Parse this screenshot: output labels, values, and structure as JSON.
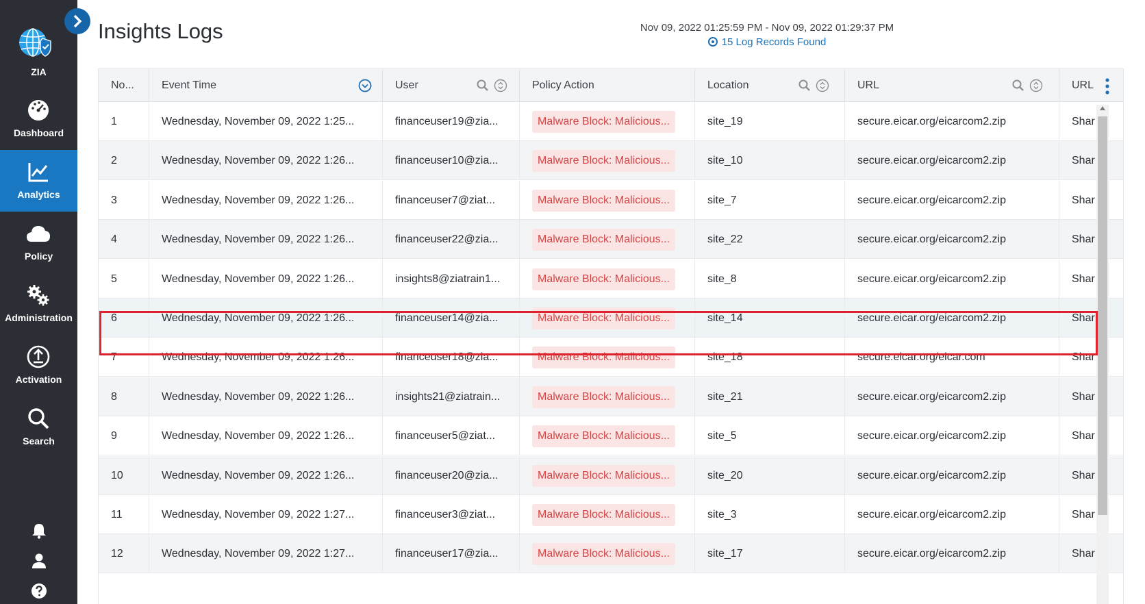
{
  "sidebar": {
    "logo_label": "ZIA",
    "items": [
      {
        "label": "Dashboard",
        "icon": "dashboard-gauge-icon"
      },
      {
        "label": "Analytics",
        "icon": "analytics-chart-icon",
        "active": true
      },
      {
        "label": "Policy",
        "icon": "cloud-icon"
      },
      {
        "label": "Administration",
        "icon": "gears-icon"
      },
      {
        "label": "Activation",
        "icon": "upload-circle-icon"
      },
      {
        "label": "Search",
        "icon": "search-icon"
      }
    ],
    "bottom_icons": [
      "bell-icon",
      "user-icon",
      "help-icon"
    ]
  },
  "header": {
    "title": "Insights Logs",
    "date_range": "Nov 09, 2022 01:25:59 PM  -  Nov 09, 2022 01:29:37 PM",
    "records_found": "15 Log Records Found"
  },
  "table": {
    "columns": [
      "No...",
      "Event Time",
      "User",
      "Policy Action",
      "Location",
      "URL",
      "URL"
    ],
    "rows": [
      {
        "no": "1",
        "time": "Wednesday, November 09, 2022 1:25...",
        "user": "financeuser19@zia...",
        "action": "Malware Block: Malicious...",
        "location": "site_19",
        "url": "secure.eicar.org/eicarcom2.zip",
        "url2": "Shar"
      },
      {
        "no": "2",
        "time": "Wednesday, November 09, 2022 1:26...",
        "user": "financeuser10@zia...",
        "action": "Malware Block: Malicious...",
        "location": "site_10",
        "url": "secure.eicar.org/eicarcom2.zip",
        "url2": "Shar"
      },
      {
        "no": "3",
        "time": "Wednesday, November 09, 2022 1:26...",
        "user": "financeuser7@ziat...",
        "action": "Malware Block: Malicious...",
        "location": "site_7",
        "url": "secure.eicar.org/eicarcom2.zip",
        "url2": "Shar"
      },
      {
        "no": "4",
        "time": "Wednesday, November 09, 2022 1:26...",
        "user": "financeuser22@zia...",
        "action": "Malware Block: Malicious...",
        "location": "site_22",
        "url": "secure.eicar.org/eicarcom2.zip",
        "url2": "Shar"
      },
      {
        "no": "5",
        "time": "Wednesday, November 09, 2022 1:26...",
        "user": "insights8@ziatrain1...",
        "action": "Malware Block: Malicious...",
        "location": "site_8",
        "url": "secure.eicar.org/eicarcom2.zip",
        "url2": "Shar"
      },
      {
        "no": "6",
        "time": "Wednesday, November 09, 2022 1:26...",
        "user": "financeuser14@zia...",
        "action": "Malware Block: Malicious...",
        "location": "site_14",
        "url": "secure.eicar.org/eicarcom2.zip",
        "url2": "Shar"
      },
      {
        "no": "7",
        "time": "Wednesday, November 09, 2022 1:26...",
        "user": "financeuser18@zia...",
        "action": "Malware Block: Malicious...",
        "location": "site_18",
        "url": "secure.eicar.org/eicar.com",
        "url2": "Shar"
      },
      {
        "no": "8",
        "time": "Wednesday, November 09, 2022 1:26...",
        "user": "insights21@ziatrain...",
        "action": "Malware Block: Malicious...",
        "location": "site_21",
        "url": "secure.eicar.org/eicarcom2.zip",
        "url2": "Shar"
      },
      {
        "no": "9",
        "time": "Wednesday, November 09, 2022 1:26...",
        "user": "financeuser5@ziat...",
        "action": "Malware Block: Malicious...",
        "location": "site_5",
        "url": "secure.eicar.org/eicarcom2.zip",
        "url2": "Shar"
      },
      {
        "no": "10",
        "time": "Wednesday, November 09, 2022 1:26...",
        "user": "financeuser20@zia...",
        "action": "Malware Block: Malicious...",
        "location": "site_20",
        "url": "secure.eicar.org/eicarcom2.zip",
        "url2": "Shar"
      },
      {
        "no": "11",
        "time": "Wednesday, November 09, 2022 1:27...",
        "user": "financeuser3@ziat...",
        "action": "Malware Block: Malicious...",
        "location": "site_3",
        "url": "secure.eicar.org/eicarcom2.zip",
        "url2": "Shar"
      },
      {
        "no": "12",
        "time": "Wednesday, November 09, 2022 1:27...",
        "user": "financeuser17@zia...",
        "action": "Malware Block: Malicious...",
        "location": "site_17",
        "url": "secure.eicar.org/eicarcom2.zip",
        "url2": "Shar"
      }
    ],
    "selected_row": "6"
  },
  "colors": {
    "sidebar_bg": "#2b2f35",
    "active_nav": "#1a78c2",
    "badge_bg": "#fbe4e4",
    "badge_text": "#d64545",
    "highlight": "#e0212e",
    "link": "#1f6fb5"
  }
}
